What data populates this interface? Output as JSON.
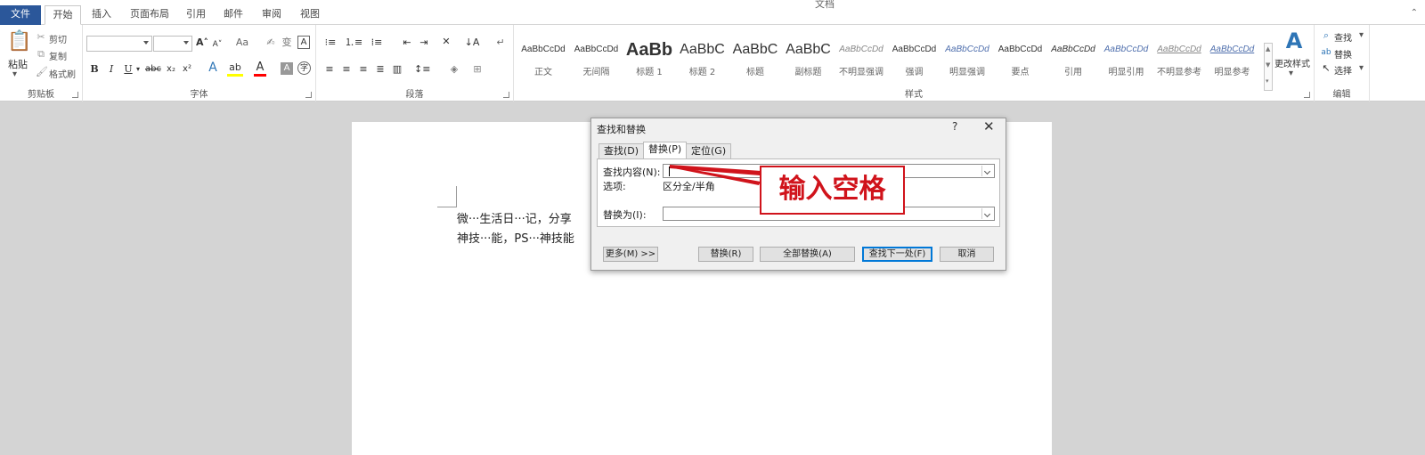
{
  "title_fragment": "文档",
  "tabs": [
    {
      "label": "文件",
      "kind": "file"
    },
    {
      "label": "开始",
      "kind": "active"
    },
    {
      "label": "插入",
      "kind": ""
    },
    {
      "label": "页面布局",
      "kind": ""
    },
    {
      "label": "引用",
      "kind": ""
    },
    {
      "label": "邮件",
      "kind": ""
    },
    {
      "label": "审阅",
      "kind": ""
    },
    {
      "label": "视图",
      "kind": ""
    }
  ],
  "clipboard": {
    "paste_label": "粘贴",
    "cut_label": "剪切",
    "copy_label": "复制",
    "format_painter_label": "格式刷",
    "group_label": "剪贴板"
  },
  "font": {
    "font_name": "",
    "font_size": "",
    "group_label": "字体"
  },
  "paragraph": {
    "group_label": "段落"
  },
  "styles": {
    "group_label": "样式",
    "items": [
      {
        "sample": "AaBbCcDd",
        "name": "正文",
        "size": 10,
        "bold": false
      },
      {
        "sample": "AaBbCcDd",
        "name": "无间隔",
        "size": 10,
        "bold": false
      },
      {
        "sample": "AaBb",
        "name": "标题 1",
        "size": 20,
        "bold": true
      },
      {
        "sample": "AaBbC",
        "name": "标题 2",
        "size": 16,
        "bold": false
      },
      {
        "sample": "AaBbC",
        "name": "标题",
        "size": 16,
        "bold": false
      },
      {
        "sample": "AaBbC",
        "name": "副标题",
        "size": 16,
        "bold": false
      },
      {
        "sample": "AaBbCcDd",
        "name": "不明显强调",
        "size": 10,
        "bold": false
      },
      {
        "sample": "AaBbCcDd",
        "name": "强调",
        "size": 10,
        "bold": false
      },
      {
        "sample": "AaBbCcDd",
        "name": "明显强调",
        "size": 10,
        "bold": false
      },
      {
        "sample": "AaBbCcDd",
        "name": "要点",
        "size": 10,
        "bold": false
      },
      {
        "sample": "AaBbCcDd",
        "name": "引用",
        "size": 10,
        "bold": false
      },
      {
        "sample": "AaBbCcDd",
        "name": "明显引用",
        "size": 10,
        "bold": false
      },
      {
        "sample": "AaBbCcDd",
        "name": "不明显参考",
        "size": 10,
        "bold": false
      },
      {
        "sample": "AaBbCcDd",
        "name": "明显参考",
        "size": 10,
        "bold": false
      }
    ],
    "change_styles_label": "更改样式"
  },
  "editing": {
    "find_label": "查找",
    "replace_label": "替换",
    "select_label": "选择",
    "group_label": "编辑"
  },
  "document": {
    "line1": "微···生活日···记，分享",
    "line2": "神技···能，PS···神技能"
  },
  "dialog": {
    "title": "查找和替换",
    "help": "?",
    "close": "✕",
    "tabs": {
      "find": "查找(D)",
      "replace": "替换(P)",
      "goto": "定位(G)"
    },
    "find_label": "查找内容(N):",
    "find_value": "",
    "options_label": "选项:",
    "options_value": "区分全/半角",
    "replace_label": "替换为(I):",
    "replace_value": "",
    "buttons": {
      "more": "更多(M) >>",
      "replace": "替换(R)",
      "replace_all": "全部替换(A)",
      "find_next": "查找下一处(F)",
      "cancel": "取消"
    }
  },
  "annotation": {
    "text": "输入空格",
    "color": "#d0131b"
  },
  "colors": {
    "file_tab": "#2b579a",
    "highlight": "#ffff00",
    "font_color": "#ff0000"
  }
}
